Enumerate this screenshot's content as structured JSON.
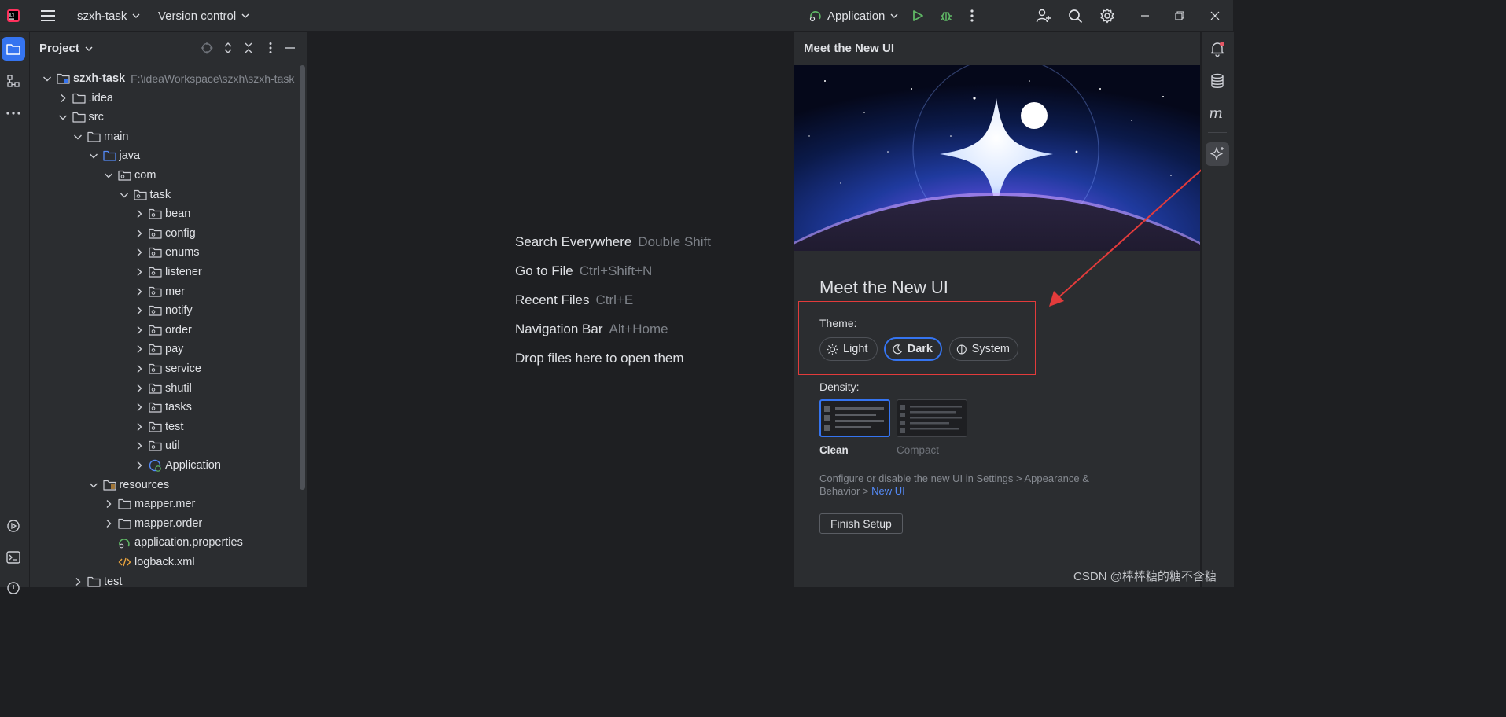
{
  "topbar": {
    "project_name": "szxh-task",
    "vcs_label": "Version control",
    "run_config": "Application"
  },
  "project_panel": {
    "title": "Project",
    "root_name": "szxh-task",
    "root_path": "F:\\ideaWorkspace\\szxh\\szxh-task",
    "tree": [
      {
        "label": "szxh-task",
        "depth": 0,
        "expanded": true,
        "icon": "module-folder-icon"
      },
      {
        "label": ".idea",
        "depth": 1,
        "expanded": false,
        "icon": "folder-icon"
      },
      {
        "label": "src",
        "depth": 1,
        "expanded": true,
        "icon": "folder-icon"
      },
      {
        "label": "main",
        "depth": 2,
        "expanded": true,
        "icon": "folder-icon"
      },
      {
        "label": "java",
        "depth": 3,
        "expanded": true,
        "icon": "source-folder-icon"
      },
      {
        "label": "com",
        "depth": 4,
        "expanded": true,
        "icon": "package-icon"
      },
      {
        "label": "task",
        "depth": 5,
        "expanded": true,
        "icon": "package-icon"
      },
      {
        "label": "bean",
        "depth": 6,
        "expanded": false,
        "icon": "package-icon"
      },
      {
        "label": "config",
        "depth": 6,
        "expanded": false,
        "icon": "package-icon"
      },
      {
        "label": "enums",
        "depth": 6,
        "expanded": false,
        "icon": "package-icon"
      },
      {
        "label": "listener",
        "depth": 6,
        "expanded": false,
        "icon": "package-icon"
      },
      {
        "label": "mer",
        "depth": 6,
        "expanded": false,
        "icon": "package-icon"
      },
      {
        "label": "notify",
        "depth": 6,
        "expanded": false,
        "icon": "package-icon"
      },
      {
        "label": "order",
        "depth": 6,
        "expanded": false,
        "icon": "package-icon"
      },
      {
        "label": "pay",
        "depth": 6,
        "expanded": false,
        "icon": "package-icon"
      },
      {
        "label": "service",
        "depth": 6,
        "expanded": false,
        "icon": "package-icon"
      },
      {
        "label": "shutil",
        "depth": 6,
        "expanded": false,
        "icon": "package-icon"
      },
      {
        "label": "tasks",
        "depth": 6,
        "expanded": false,
        "icon": "package-icon"
      },
      {
        "label": "test",
        "depth": 6,
        "expanded": false,
        "icon": "package-icon"
      },
      {
        "label": "util",
        "depth": 6,
        "expanded": false,
        "icon": "package-icon"
      },
      {
        "label": "Application",
        "depth": 6,
        "expanded": false,
        "icon": "spring-class-icon"
      },
      {
        "label": "resources",
        "depth": 3,
        "expanded": true,
        "icon": "resources-folder-icon"
      },
      {
        "label": "mapper.mer",
        "depth": 4,
        "expanded": false,
        "icon": "folder-icon"
      },
      {
        "label": "mapper.order",
        "depth": 4,
        "expanded": false,
        "icon": "folder-icon"
      },
      {
        "label": "application.properties",
        "depth": 4,
        "leaf": true,
        "icon": "spring-properties-icon"
      },
      {
        "label": "logback.xml",
        "depth": 4,
        "leaf": true,
        "icon": "xml-file-icon"
      },
      {
        "label": "test",
        "depth": 2,
        "expanded": false,
        "icon": "folder-icon"
      }
    ]
  },
  "editor": {
    "hints": [
      {
        "action": "Search Everywhere",
        "shortcut": "Double Shift"
      },
      {
        "action": "Go to File",
        "shortcut": "Ctrl+Shift+N"
      },
      {
        "action": "Recent Files",
        "shortcut": "Ctrl+E"
      },
      {
        "action": "Navigation Bar",
        "shortcut": "Alt+Home"
      },
      {
        "action": "Drop files here to open them",
        "shortcut": ""
      }
    ]
  },
  "new_ui_panel": {
    "header": "Meet the New UI",
    "title": "Meet the New UI",
    "theme_label": "Theme:",
    "themes": [
      "Light",
      "Dark",
      "System"
    ],
    "selected_theme": "Dark",
    "density_label": "Density:",
    "densities": [
      "Clean",
      "Compact"
    ],
    "selected_density": "Clean",
    "description": "Configure or disable the new UI in Settings > Appearance & Behavior > ",
    "description_link": "New UI",
    "finish_button": "Finish Setup"
  },
  "watermark": "CSDN @棒棒糖的糖不含糖",
  "colors": {
    "background": "#1e1f22",
    "panel": "#2b2d30",
    "accent": "#3574f0",
    "run_green": "#5fb865",
    "highlight_red": "#e23b3b"
  }
}
